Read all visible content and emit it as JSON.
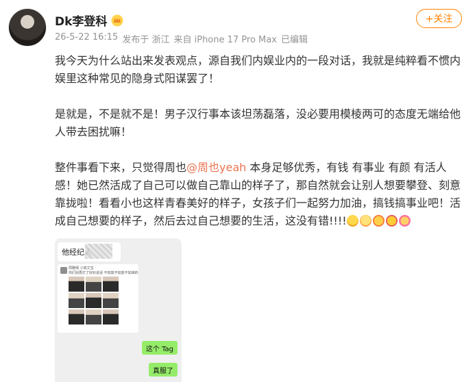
{
  "post": {
    "username": "Dk李登科",
    "badge_icon": "crown-badge",
    "timestamp": "26-5-22 16:15",
    "location": "发布于 浙江",
    "device": "来自 iPhone 17 Pro Max",
    "edited": "已编辑",
    "follow_label": "+关注",
    "paragraphs": [
      "我今天为什么站出来发表观点，源自我们内娱业内的一段对话，我就是纯粹看不惯内娱里这种常见的隐身式阳谋罢了！",
      "是就是，不是就不是！男子汉行事本该坦荡磊落，没必要用模棱两可的态度无端给他人带去困扰嘛！"
    ],
    "p3_before": "整件事看下来，只觉得周也",
    "mention": "@周也yeah",
    "p3_after": " 本身足够优秀，有钱 有事业 有颜 有活人感！她已然活成了自己可以做自己靠山的样子了，那自然就会让别人想要攀登、刻意靠拢啦！看看小也这样青春美好的样子，女孩子们一起努力加油，搞钱搞事业吧！活成自己想要的样子，然后去过自己想要的生活，这没有错!!!!",
    "emoji_icons": [
      "crying-emoji",
      "love-emoji",
      "cheer-emoji",
      "heart-eyes-emoji",
      "party-emoji"
    ]
  },
  "screenshot": {
    "chat_title": "他经纪人",
    "card_line1": "周雅晴  小高艾宝",
    "card_line2": "你们别再打了好好说话  不如放不如放不如谁的",
    "bubble_1": "这个 Tag",
    "bubble_2": "真服了"
  },
  "colors": {
    "accent": "#ff8200",
    "mention": "#eb7350",
    "wechat_bubble": "#95ec69"
  }
}
